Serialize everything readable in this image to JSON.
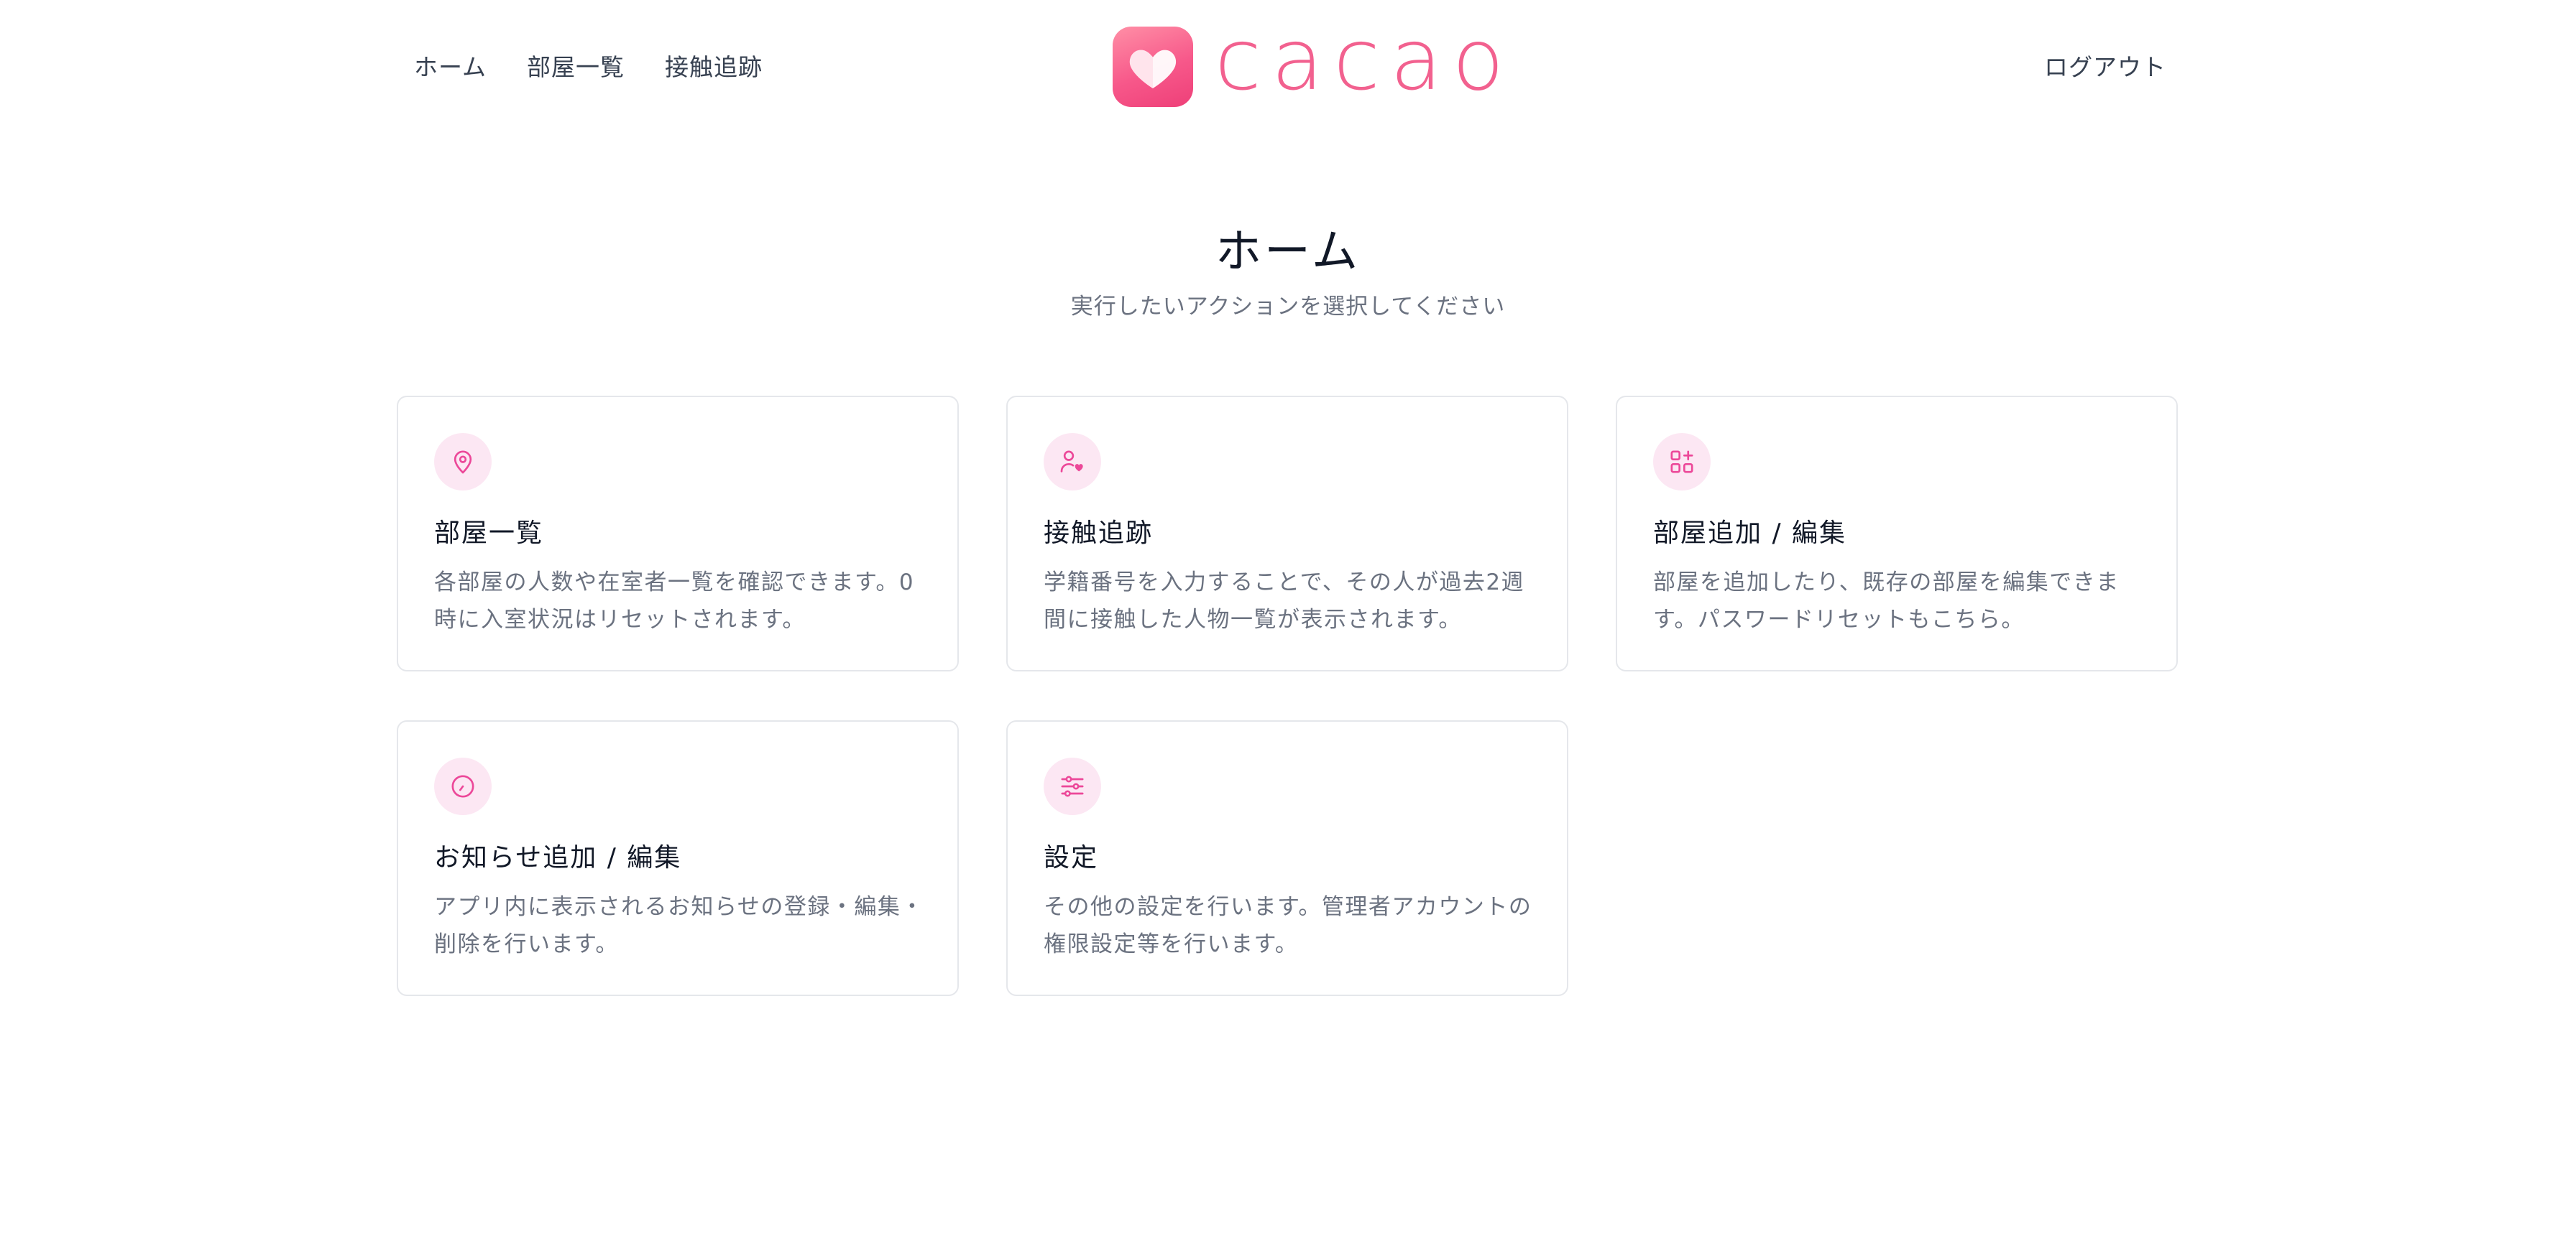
{
  "nav": {
    "items": [
      {
        "label": "ホーム"
      },
      {
        "label": "部屋一覧"
      },
      {
        "label": "接触追跡"
      }
    ],
    "logout_label": "ログアウト"
  },
  "brand": {
    "name": "cacao",
    "logo_icon": "heart-icon",
    "color": "#f2618f"
  },
  "page": {
    "title": "ホーム",
    "subtitle": "実行したいアクションを選択してください"
  },
  "cards": [
    {
      "icon": "map-pin-icon",
      "title": "部屋一覧",
      "description": "各部屋の人数や在室者一覧を確認できます。0時に入室状況はリセットされます。"
    },
    {
      "icon": "user-heart-icon",
      "title": "接触追跡",
      "description": "学籍番号を入力することで、その人が過去2週間に接触した人物一覧が表示されます。"
    },
    {
      "icon": "grid-plus-icon",
      "title": "部屋追加 / 編集",
      "description": "部屋を追加したり、既存の部屋を編集できます。パスワードリセットもこちら。"
    },
    {
      "icon": "clock-icon",
      "title": "お知らせ追加 / 編集",
      "description": "アプリ内に表示されるお知らせの登録・編集・削除を行います。"
    },
    {
      "icon": "sliders-icon",
      "title": "設定",
      "description": "その他の設定を行います。管理者アカウントの権限設定等を行います。"
    }
  ],
  "colors": {
    "accent": "#ec4899",
    "icon_bg": "#fce7f3",
    "border": "#e5e7eb"
  }
}
